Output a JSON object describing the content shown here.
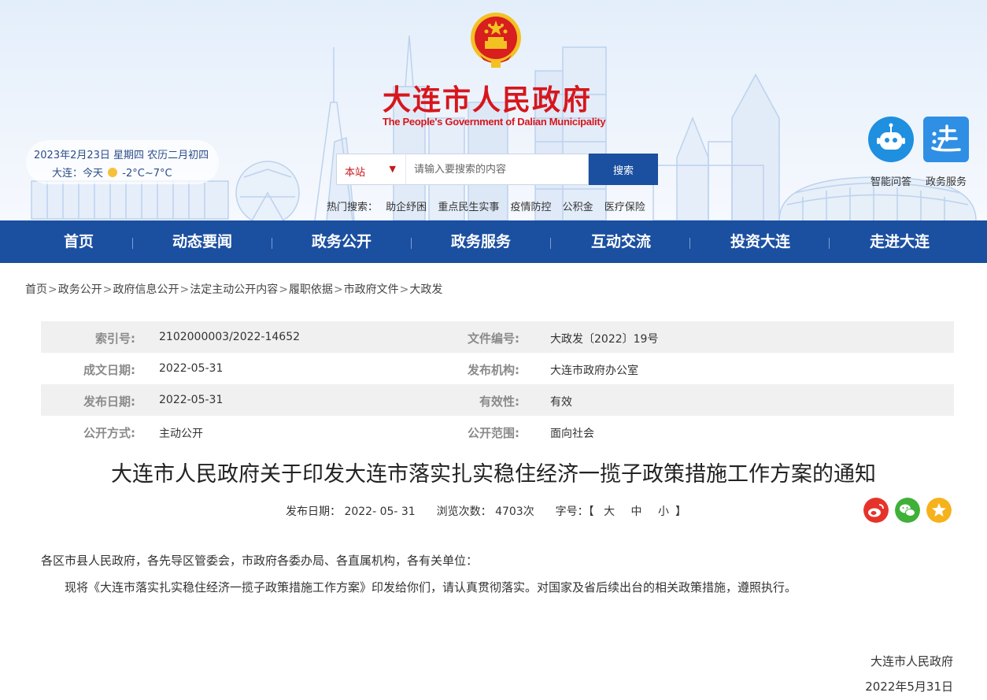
{
  "header": {
    "title_cn": "大连市人民政府",
    "title_en": "The People's Government of Dalian Municipality",
    "date_line": "2023年2月23日 星期四 农历二月初四",
    "weather_city": "大连：今天",
    "weather_temp": "-2°C~7°C",
    "search": {
      "scope": "本站",
      "placeholder": "请输入要搜索的内容",
      "button": "搜索"
    },
    "hot": {
      "label": "热门搜索：",
      "items": [
        "助企纾困",
        "重点民生实事",
        "疫情防控",
        "公积金",
        "医疗保险"
      ]
    },
    "services": [
      {
        "label": "智能问答",
        "icon": "robot-icon"
      },
      {
        "label": "政务服务",
        "icon": "gov-service-icon"
      }
    ]
  },
  "nav": [
    "首页",
    "动态要闻",
    "政务公开",
    "政务服务",
    "互动交流",
    "投资大连",
    "走进大连"
  ],
  "breadcrumb": [
    "首页",
    "政务公开",
    "政府信息公开",
    "法定主动公开内容",
    "履职依据",
    "市政府文件",
    "大政发"
  ],
  "meta": {
    "index_label": "索引号:",
    "index_value": "2102000003/2022-14652",
    "docno_label": "文件编号:",
    "docno_value": "大政发〔2022〕19号",
    "created_label": "成文日期:",
    "created_value": "2022-05-31",
    "org_label": "发布机构:",
    "org_value": "大连市政府办公室",
    "published_label": "发布日期:",
    "published_value": "2022-05-31",
    "validity_label": "有效性:",
    "validity_value": "有效",
    "mode_label": "公开方式:",
    "mode_value": "主动公开",
    "scope_label": "公开范围:",
    "scope_value": "面向社会"
  },
  "article": {
    "title": "大连市人民政府关于印发大连市落实扎实稳住经济一揽子政策措施工作方案的通知",
    "date_label": "发布日期：",
    "date_value": "2022- 05- 31",
    "views_label": "浏览次数：",
    "views_value": "4703次",
    "fontsize_label": "字号：",
    "bracket_open": "【",
    "bracket_close": "】",
    "font_large": "大",
    "font_medium": "中",
    "font_small": "小",
    "salutation": "各区市县人民政府，各先导区管委会，市政府各委办局、各直属机构，各有关单位：",
    "paragraph": "现将《大连市落实扎实稳住经济一揽子政策措施工作方案》印发给你们，请认真贯彻落实。对国家及省后续出台的相关政策措施，遵照执行。",
    "signature": "大连市人民政府",
    "sign_date": "2022年5月31日"
  },
  "share": [
    {
      "icon": "weibo-icon",
      "color": "#e6332a"
    },
    {
      "icon": "wechat-icon",
      "color": "#3fb038"
    },
    {
      "icon": "favorite-star-icon",
      "color": "#f5b21b"
    }
  ],
  "colors": {
    "brand_blue": "#1b4fa0",
    "title_red": "#d7161c",
    "meta_shade": "#f0f0f0"
  }
}
